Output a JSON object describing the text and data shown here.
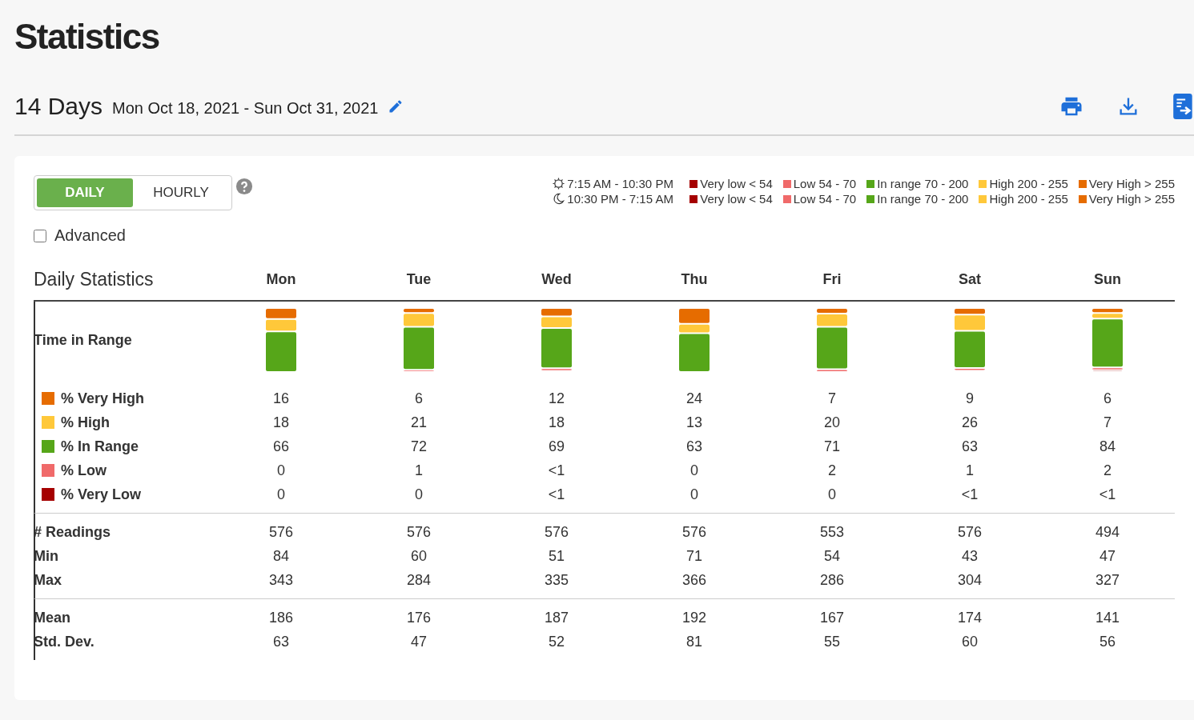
{
  "title": "Statistics",
  "range": {
    "length": "14 Days",
    "dates": "Mon Oct 18, 2021 - Sun Oct 31, 2021"
  },
  "toggle": [
    {
      "label": "DAILY",
      "selected": true
    },
    {
      "label": "HOURLY",
      "selected": false
    }
  ],
  "advanced": {
    "label": "Advanced",
    "checked": false
  },
  "legend": [
    {
      "kind": "day",
      "time": "7:15 AM - 10:30 PM",
      "items": [
        {
          "label": "Very low < 54",
          "color": "#a50000"
        },
        {
          "label": "Low 54 - 70",
          "color": "#f06a6a"
        },
        {
          "label": "In range 70 - 200",
          "color": "#56a619"
        },
        {
          "label": "High 200 - 255",
          "color": "#ffc83a"
        },
        {
          "label": "Very High > 255",
          "color": "#e66c00"
        }
      ]
    },
    {
      "kind": "night",
      "time": "10:30 PM - 7:15 AM",
      "items": [
        {
          "label": "Very low < 54",
          "color": "#a50000"
        },
        {
          "label": "Low 54 - 70",
          "color": "#f06a6a"
        },
        {
          "label": "In range 70 - 200",
          "color": "#56a619"
        },
        {
          "label": "High 200 - 255",
          "color": "#ffc83a"
        },
        {
          "label": "Very High > 255",
          "color": "#e66c00"
        }
      ]
    }
  ],
  "table": {
    "heading": "Daily Statistics",
    "days": [
      "Mon",
      "Tue",
      "Wed",
      "Thu",
      "Fri",
      "Sat",
      "Sun"
    ],
    "time_in_range_label": "Time in Range",
    "range_rows": [
      {
        "label": "% Very High",
        "color": "#e66c00",
        "values": [
          "16",
          "6",
          "12",
          "24",
          "7",
          "9",
          "6"
        ]
      },
      {
        "label": "% High",
        "color": "#ffc83a",
        "values": [
          "18",
          "21",
          "18",
          "13",
          "20",
          "26",
          "7"
        ]
      },
      {
        "label": "% In Range",
        "color": "#56a619",
        "values": [
          "66",
          "72",
          "69",
          "63",
          "71",
          "63",
          "84"
        ]
      },
      {
        "label": "% Low",
        "color": "#f06a6a",
        "values": [
          "0",
          "1",
          "<1",
          "0",
          "2",
          "1",
          "2"
        ]
      },
      {
        "label": "% Very Low",
        "color": "#a50000",
        "values": [
          "0",
          "0",
          "<1",
          "0",
          "0",
          "<1",
          "<1"
        ]
      }
    ],
    "groups": [
      [
        {
          "label": "# Readings",
          "values": [
            "576",
            "576",
            "576",
            "576",
            "553",
            "576",
            "494"
          ]
        },
        {
          "label": "Min",
          "values": [
            "84",
            "60",
            "51",
            "71",
            "54",
            "43",
            "47"
          ]
        },
        {
          "label": "Max",
          "values": [
            "343",
            "284",
            "335",
            "366",
            "286",
            "304",
            "327"
          ]
        }
      ],
      [
        {
          "label": "Mean",
          "values": [
            "186",
            "176",
            "187",
            "192",
            "167",
            "174",
            "141"
          ]
        },
        {
          "label": "Std. Dev.",
          "values": [
            "63",
            "47",
            "52",
            "81",
            "55",
            "60",
            "56"
          ]
        }
      ]
    ]
  }
}
